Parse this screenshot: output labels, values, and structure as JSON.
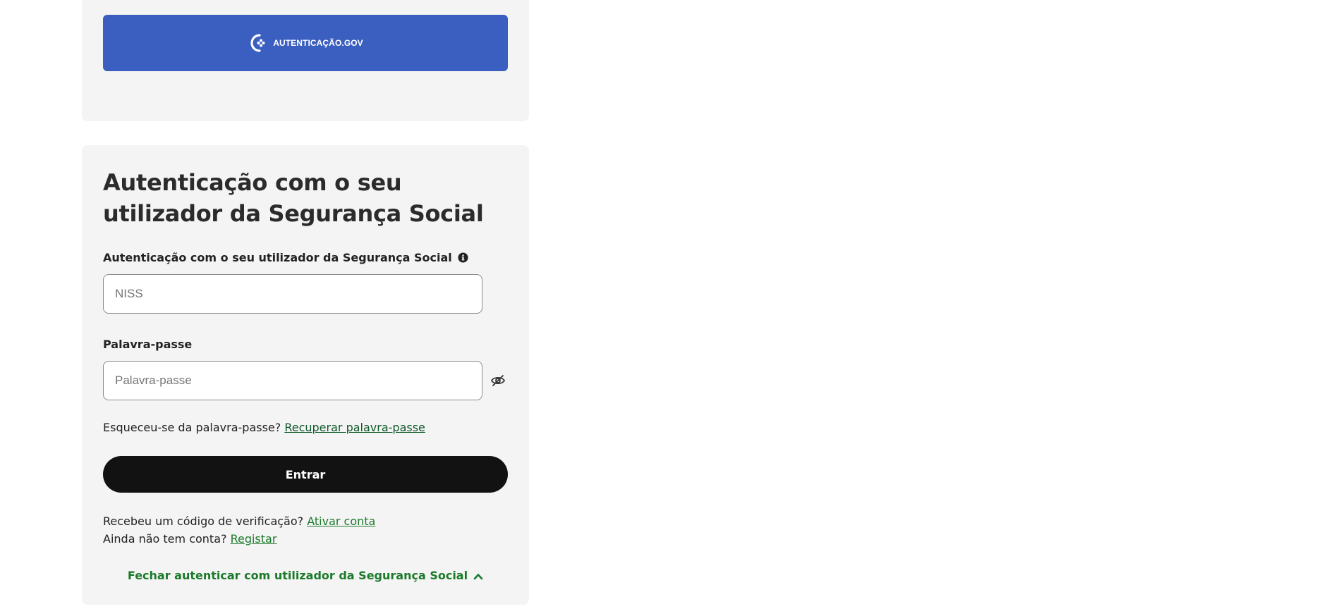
{
  "colors": {
    "gov_button_bg": "#3b5fc0",
    "card_bg": "#f4f4f4",
    "primary_button_bg": "#121212",
    "link_green": "#1a7a2a"
  },
  "gov": {
    "button_label": "AUTENTICAÇÃO.GOV",
    "logo_icon": "autenticacao-gov-logo-icon"
  },
  "auth": {
    "title": "Autenticação com o seu utilizador da Segurança Social",
    "user_label": "Autenticação com o seu utilizador da Segurança Social",
    "user_info_icon": "info-circle-icon",
    "user_placeholder": "NISS",
    "password_label": "Palavra-passe",
    "password_placeholder": "Palavra-passe",
    "password_toggle_icon": "eye-slash-icon",
    "forgot_prefix": "Esqueceu-se da palavra-passe? ",
    "forgot_link": "Recuperar palavra-passe",
    "submit_label": "Entrar",
    "activate_prefix": "Recebeu um código de verificação? ",
    "activate_link": "Ativar conta",
    "register_prefix": "Ainda não tem conta? ",
    "register_link": "Registar",
    "close_label": "Fechar autenticar com utilizador da Segurança Social",
    "close_icon": "chevron-up-icon"
  }
}
